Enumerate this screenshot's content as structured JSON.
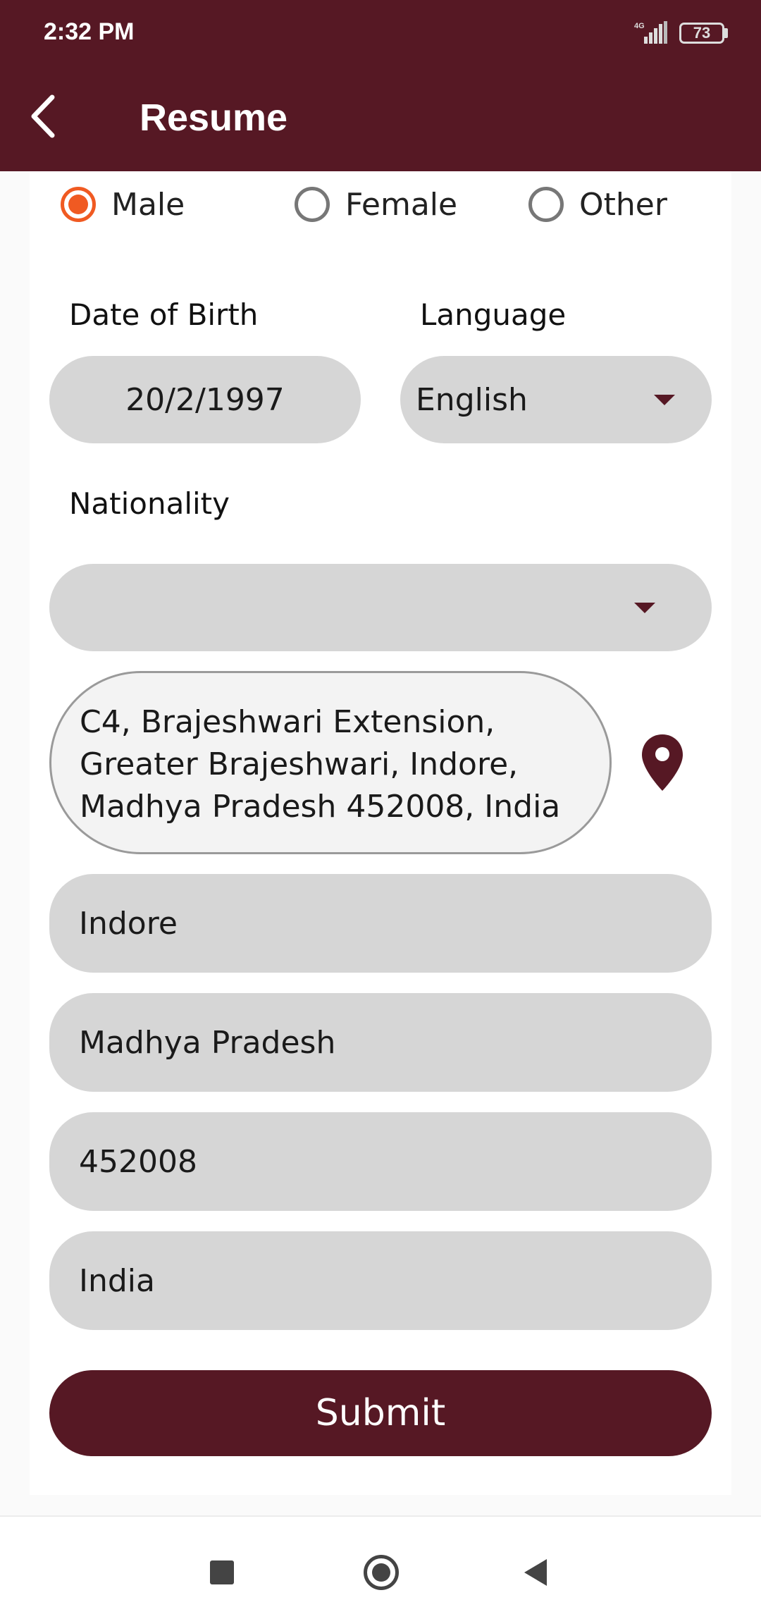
{
  "status_bar": {
    "time": "2:32 PM",
    "network": "4G",
    "battery": "73"
  },
  "app_bar": {
    "title": "Resume",
    "back_icon": "chevron-left-icon"
  },
  "gender": {
    "options": [
      "Male",
      "Female",
      "Other"
    ],
    "selected": "Male"
  },
  "date_of_birth": {
    "label": "Date of Birth",
    "value": "20/2/1997"
  },
  "language": {
    "label": "Language",
    "value": "English"
  },
  "nationality": {
    "label": "Nationality",
    "value": ""
  },
  "address": {
    "value": "C4, Brajeshwari Extension, Greater Brajeshwari, Indore, Madhya Pradesh 452008, India",
    "location_icon": "map-pin-icon"
  },
  "city": {
    "value": "Indore"
  },
  "state": {
    "value": "Madhya Pradesh"
  },
  "pincode": {
    "value": "452008"
  },
  "country": {
    "value": "India"
  },
  "submit": {
    "label": "Submit"
  },
  "colors": {
    "primary": "#561824",
    "radio_accent": "#f05a22",
    "field_bg": "#d6d6d6"
  }
}
